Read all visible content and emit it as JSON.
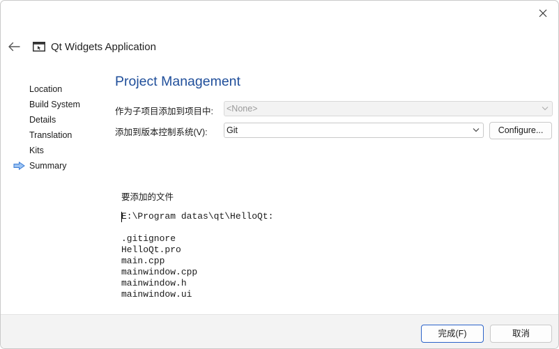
{
  "window": {
    "title": "Qt Widgets Application"
  },
  "sidebar": {
    "items": [
      {
        "label": "Location"
      },
      {
        "label": "Build System"
      },
      {
        "label": "Details"
      },
      {
        "label": "Translation"
      },
      {
        "label": "Kits"
      },
      {
        "label": "Summary",
        "current": true
      }
    ]
  },
  "page": {
    "title": "Project Management",
    "subproject_label": "作为子项目添加到项目中:",
    "subproject_value": "<None>",
    "vcs_label": "添加到版本控制系统(V):",
    "vcs_value": "Git",
    "configure_label": "Configure..."
  },
  "files": {
    "heading": "要添加的文件",
    "path": "E:\\Program datas\\qt\\HelloQt:",
    "items": [
      ".gitignore",
      "HelloQt.pro",
      "main.cpp",
      "mainwindow.cpp",
      "mainwindow.h",
      "mainwindow.ui"
    ]
  },
  "footer": {
    "finish_label": "完成(F)",
    "cancel_label": "取消"
  },
  "colors": {
    "title_blue": "#1f4e9a",
    "arrow_blue": "#3a7bd5",
    "default_button_border": "#2a62c9"
  },
  "icons": [
    "close-icon",
    "back-arrow-icon",
    "qt-widgets-app-icon",
    "current-step-arrow-icon",
    "chevron-down-icon"
  ]
}
